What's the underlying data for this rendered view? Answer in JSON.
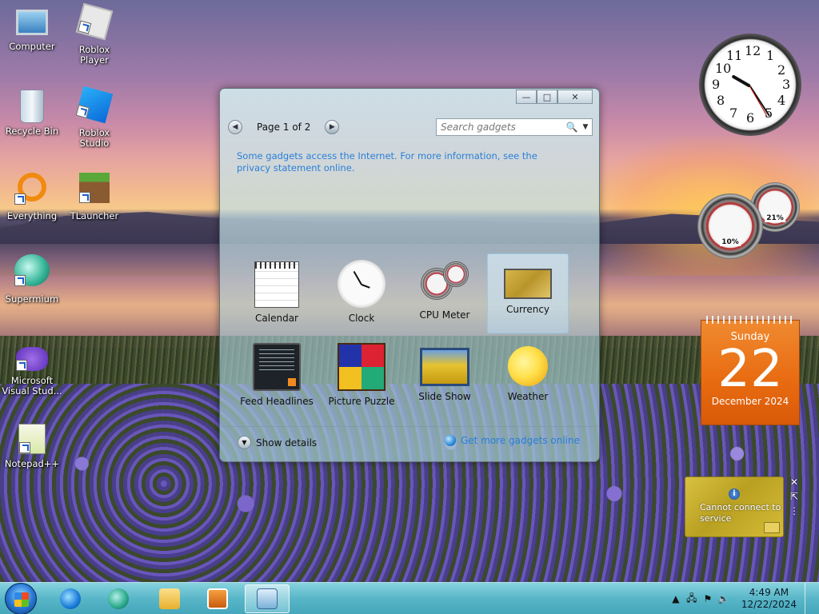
{
  "desktop": {
    "icons": [
      {
        "label": "Computer"
      },
      {
        "label": "Roblox Player"
      },
      {
        "label": "Recycle Bin"
      },
      {
        "label": "Roblox Studio"
      },
      {
        "label": "Everything"
      },
      {
        "label": "TLauncher"
      },
      {
        "label": "Supermium"
      },
      {
        "label": "Microsoft Visual Stud..."
      },
      {
        "label": "Notepad++"
      }
    ]
  },
  "gallery": {
    "caption": {
      "minimize": "—",
      "maximize": "□",
      "close": "✕"
    },
    "pager": {
      "prev": "◀",
      "text": "Page 1 of 2",
      "next": "▶"
    },
    "search": {
      "placeholder": "Search gadgets",
      "icon": "🔍",
      "dropdown": "▼"
    },
    "notice": "Some gadgets access the Internet.  For more information, see the privacy statement online.",
    "items": [
      {
        "label": "Calendar",
        "icon": "calendar-icon"
      },
      {
        "label": "Clock",
        "icon": "clock-icon"
      },
      {
        "label": "CPU Meter",
        "icon": "cpu-meter-icon"
      },
      {
        "label": "Currency",
        "icon": "currency-icon",
        "selected": true
      },
      {
        "label": "Feed Headlines",
        "icon": "feed-icon"
      },
      {
        "label": "Picture Puzzle",
        "icon": "puzzle-icon"
      },
      {
        "label": "Slide Show",
        "icon": "slideshow-icon"
      },
      {
        "label": "Weather",
        "icon": "weather-icon"
      }
    ],
    "show_details": "Show details",
    "get_more": "Get more gadgets online"
  },
  "gadgets": {
    "clock": {
      "numerals": [
        "12",
        "1",
        "2",
        "3",
        "4",
        "5",
        "6",
        "7",
        "8",
        "9",
        "10",
        "11"
      ]
    },
    "cpu": {
      "cpu_pct": "10%",
      "mem_pct": "21%"
    },
    "calendar": {
      "weekday": "Sunday",
      "day": "22",
      "month_year": "December 2024"
    },
    "currency": {
      "message": "Cannot connect to service",
      "info": "i"
    },
    "side_controls": {
      "close": "✕",
      "expand": "⇱",
      "drag": "⋮"
    }
  },
  "taskbar": {
    "tray": {
      "time": "4:49 AM",
      "date": "12/22/2024",
      "arrow": "▲"
    }
  },
  "colors": {
    "calendar_accent": "#e86a10",
    "link_blue": "#2a7fd8",
    "taskbar": "#5abecd"
  }
}
